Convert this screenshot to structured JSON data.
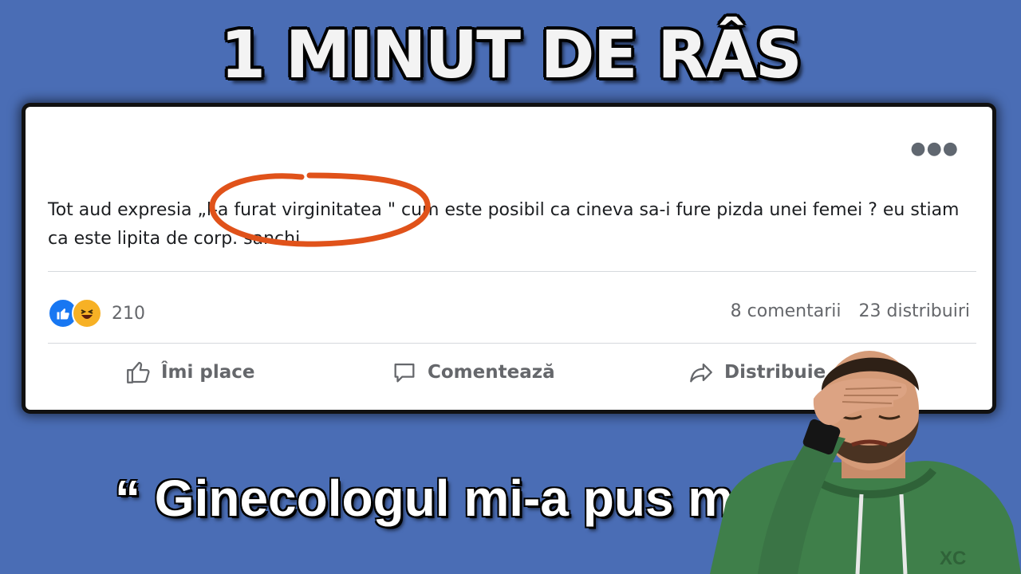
{
  "thumbnail": {
    "title": "1 MINUT DE RÂS",
    "caption": "“ Ginecologul mi-a pus man"
  },
  "post": {
    "more_icon": "ellipsis-icon",
    "text": "Tot aud expresia „l-a furat virginitatea \" cum este posibil ca cineva sa-i fure pizda unei femei ? eu stiam ca este lipita de corp. sanchi",
    "highlight_color": "#e0521a",
    "reactions": {
      "icons": [
        "like-icon",
        "haha-icon"
      ],
      "count": "210"
    },
    "comments": "8 comentarii",
    "shares": "23 distribuiri",
    "actions": {
      "like": "Îmi place",
      "comment": "Comentează",
      "share": "Distribuie"
    }
  },
  "colors": {
    "background": "#4a6db5",
    "like_blue": "#1877f2",
    "haha_yellow": "#f7b125",
    "hoodie_green": "#3f7f4a"
  },
  "overlay": {
    "watermark": "XC"
  }
}
